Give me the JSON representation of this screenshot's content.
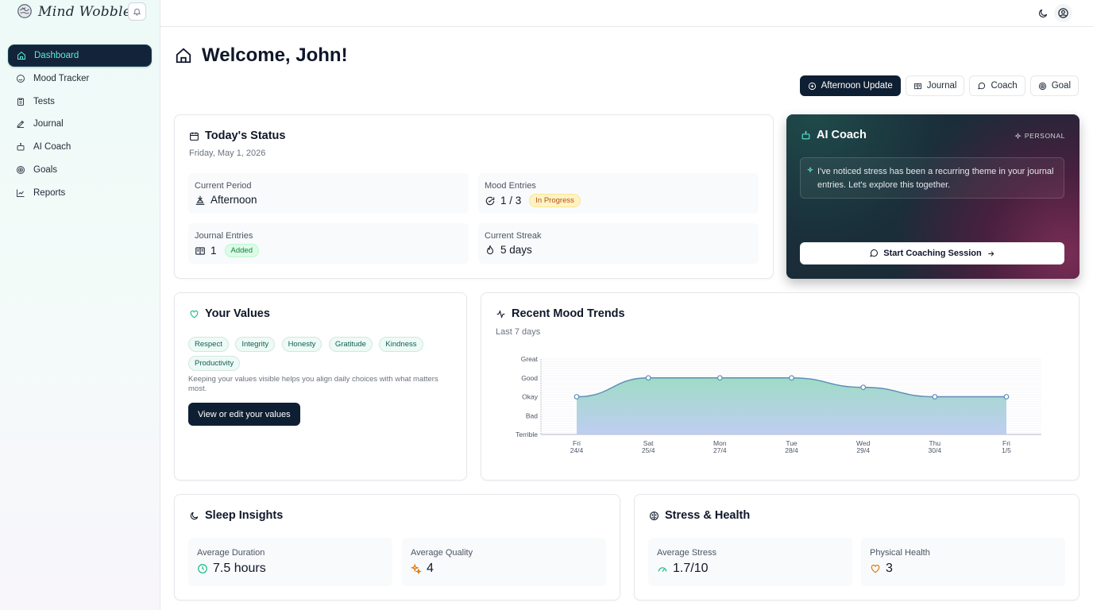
{
  "app": {
    "name": "Mind Wobble"
  },
  "sidebar": {
    "items": [
      {
        "label": "Dashboard",
        "icon": "home-icon"
      },
      {
        "label": "Mood Tracker",
        "icon": "smile-icon"
      },
      {
        "label": "Tests",
        "icon": "clipboard-icon"
      },
      {
        "label": "Journal",
        "icon": "pen-icon"
      },
      {
        "label": "AI Coach",
        "icon": "bot-icon"
      },
      {
        "label": "Goals",
        "icon": "target-icon"
      },
      {
        "label": "Reports",
        "icon": "chart-icon"
      }
    ]
  },
  "header": {
    "welcome": "Welcome, John!"
  },
  "actions": {
    "afternoon_update": "Afternoon Update",
    "journal": "Journal",
    "coach": "Coach",
    "goal": "Goal"
  },
  "status": {
    "title": "Today's Status",
    "date": "Friday, May 1, 2026",
    "current_period_label": "Current Period",
    "current_period_value": "Afternoon",
    "mood_entries_label": "Mood Entries",
    "mood_entries_value": "1 / 3",
    "mood_entries_badge": "In Progress",
    "journal_entries_label": "Journal Entries",
    "journal_entries_value": "1",
    "journal_entries_badge": "Added",
    "streak_label": "Current Streak",
    "streak_value": "5 days"
  },
  "coach": {
    "title": "AI Coach",
    "tag": "PERSONAL",
    "message": "I've noticed stress has been a recurring theme in your journal entries. Let's explore this together.",
    "button": "Start Coaching Session"
  },
  "values": {
    "title": "Your Values",
    "chips": [
      "Respect",
      "Integrity",
      "Honesty",
      "Gratitude",
      "Kindness",
      "Productivity"
    ],
    "note": "Keeping your values visible helps you align daily choices with what matters most.",
    "button": "View or edit your values"
  },
  "mood": {
    "title": "Recent Mood Trends",
    "subtitle": "Last 7 days"
  },
  "chart_data": {
    "type": "area",
    "title": "Recent Mood Trends",
    "y_levels": [
      "Terrible",
      "Bad",
      "Okay",
      "Good",
      "Great"
    ],
    "categories": [
      {
        "day": "Fri",
        "date": "24/4"
      },
      {
        "day": "Sat",
        "date": "25/4"
      },
      {
        "day": "Mon",
        "date": "27/4"
      },
      {
        "day": "Tue",
        "date": "28/4"
      },
      {
        "day": "Wed",
        "date": "29/4"
      },
      {
        "day": "Thu",
        "date": "30/4"
      },
      {
        "day": "Fri",
        "date": "1/5"
      }
    ],
    "values": [
      2,
      3,
      3,
      3,
      2.5,
      2,
      2
    ],
    "ylim": [
      0,
      4
    ],
    "grid": true,
    "line_color": "#5b8db8",
    "fill_top": "#8fd6bd",
    "fill_bottom": "#b9c8f0"
  },
  "sleep": {
    "title": "Sleep Insights",
    "duration_label": "Average Duration",
    "duration_value": "7.5 hours",
    "quality_label": "Average Quality",
    "quality_value": "4"
  },
  "health": {
    "title": "Stress & Health",
    "stress_label": "Average Stress",
    "stress_value": "1.7/10",
    "physical_label": "Physical Health",
    "physical_value": "3"
  },
  "colors": {
    "primary_dark": "#0f1f33",
    "accent_teal": "#5eead4",
    "badge_orange": "#b45309",
    "badge_green": "#15803d"
  }
}
